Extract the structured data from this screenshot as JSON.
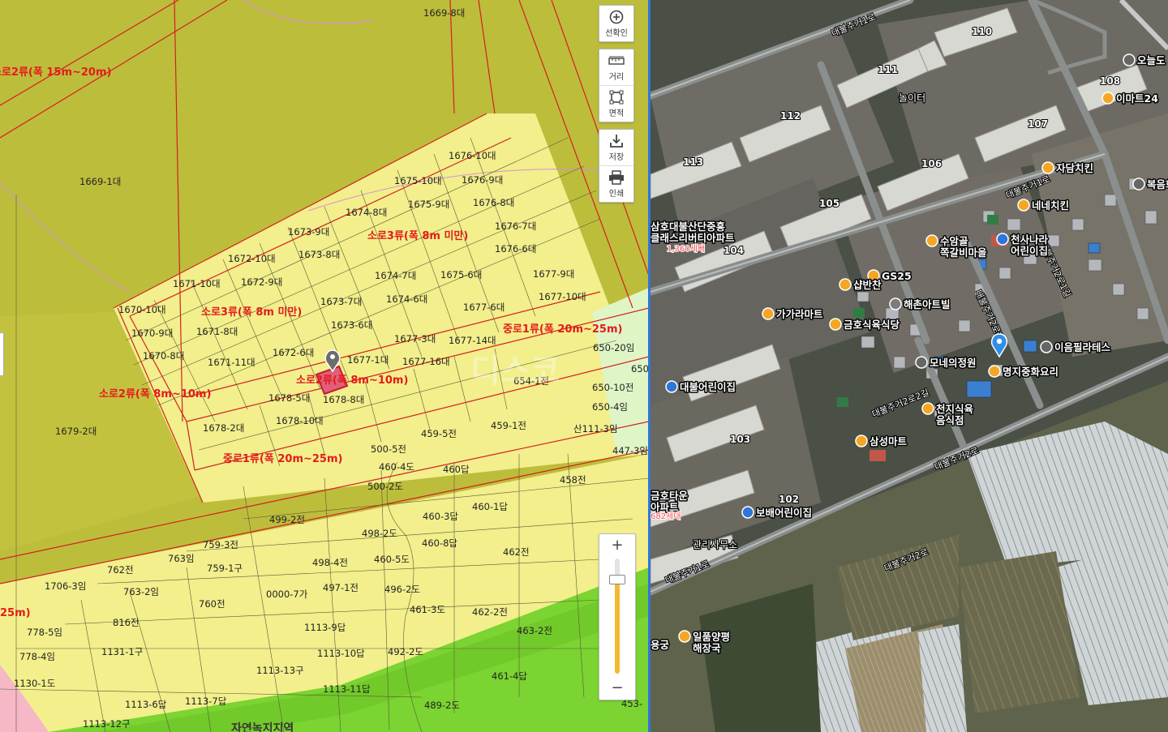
{
  "toolbar": {
    "buttons": [
      {
        "id": "select",
        "label": "선확인",
        "icon": "plus-circle-icon"
      },
      {
        "id": "distance",
        "label": "거리",
        "icon": "ruler-icon"
      },
      {
        "id": "area",
        "label": "면적",
        "icon": "area-icon"
      },
      {
        "id": "save",
        "label": "저장",
        "icon": "download-icon"
      },
      {
        "id": "print",
        "label": "인쇄",
        "icon": "printer-icon"
      }
    ]
  },
  "zoom": {
    "plus": "+",
    "minus": "−",
    "level": 0.85
  },
  "watermark": "디스코",
  "cadastral": {
    "parcels": [
      "1669-8대",
      "1669-1대",
      "1679-2대",
      "1676-10대",
      "1676-9대",
      "1675-10대",
      "1675-9대",
      "1676-8대",
      "1674-8대",
      "1676-7대",
      "1673-9대",
      "1676-6대",
      "1672-10대",
      "1673-8대",
      "1675-6대",
      "1677-9대",
      "1671-10대",
      "1672-9대",
      "1674-7대",
      "1677-10대",
      "1670-10대",
      "1673-7대",
      "1674-6대",
      "1677-6대",
      "1670-9대",
      "1671-8대",
      "1673-6대",
      "1677-3대",
      "1677-14대",
      "1670-8대",
      "1672-6대",
      "1671-11대",
      "1677-1대",
      "1677-16대",
      "1678-5대",
      "1678-8대",
      "1678-10대",
      "1678-2대",
      "650-20임",
      "650",
      "654-1전",
      "650-10전",
      "650-4임",
      "459-1전",
      "459-5전",
      "산111-3임",
      "447-3임",
      "500-5전",
      "460-4도",
      "460답",
      "500-2도",
      "458전",
      "499-2전",
      "460-3답",
      "460-1답",
      "759-3전",
      "498-2도",
      "460-8답",
      "763임",
      "462전",
      "762전",
      "759-1구",
      "498-4전",
      "460-5도",
      "1706-3임",
      "763-2임",
      "497-1전",
      "496-2도",
      "760전",
      "0000-7가",
      "461-3도",
      "462-2전",
      "778-5임",
      "816전",
      "1113-9답",
      "463-2전",
      "778-4임",
      "1131-1구",
      "1113-10답",
      "492-2도",
      "1113-13구",
      "461-4답",
      "1130-1도",
      "1113-11답",
      "1113-6답",
      "1113-7답",
      "489-2도",
      "1113-12구",
      "453-"
    ],
    "roads": [
      "소로2류(폭 15m~20m)",
      "소로3류(폭 8m 미만)",
      "소로3류(폭 8m 미만)",
      "중로1류(폭 20m~25m)",
      "소로2류(폭 8m~10m)",
      "소로2류(폭 8m~10m)",
      "중로1류(폭 20m~25m)",
      "25m)"
    ],
    "zones": [
      "자연녹지지역"
    ]
  },
  "satellite": {
    "roads": [
      "대불주거1로",
      "대불주거1로",
      "대불주거2로",
      "대불주거2로",
      "대불주거2로2길",
      "대불주거2로3길",
      "대불주거2로1길",
      "대불주거1로"
    ],
    "buildings": [
      "110",
      "111",
      "112",
      "113",
      "108",
      "107",
      "106",
      "105",
      "104",
      "103",
      "102"
    ],
    "labels": [
      "놀이터",
      "관리사무소"
    ],
    "pois": [
      {
        "name": "오늘도",
        "type": "person"
      },
      {
        "name": "이마트24",
        "type": "shop"
      },
      {
        "name": "자담치킨",
        "type": "food"
      },
      {
        "name": "복음화교회",
        "type": "church"
      },
      {
        "name": "네네치킨",
        "type": "food"
      },
      {
        "name": "삼호대불산단중흥\n클래스리버티아파트",
        "type": "apt"
      },
      {
        "name": "수암골\n쪽갈비마을",
        "type": "food"
      },
      {
        "name": "천사나라\n어린이집",
        "type": "kid"
      },
      {
        "name": "GS25",
        "type": "shop"
      },
      {
        "name": "샵반찬",
        "type": "shop"
      },
      {
        "name": "가가라마트",
        "type": "shop"
      },
      {
        "name": "해촌아트빌",
        "type": "apt"
      },
      {
        "name": "금호식육식당",
        "type": "food"
      },
      {
        "name": "모네의정원",
        "type": "person"
      },
      {
        "name": "이음필라테스",
        "type": "person"
      },
      {
        "name": "명지중화요리",
        "type": "food"
      },
      {
        "name": "대불어린이집",
        "type": "kid"
      },
      {
        "name": "천지식육\n음식점",
        "type": "food"
      },
      {
        "name": "삼성마트",
        "type": "shop"
      },
      {
        "name": "금호타운\n아파트",
        "type": "apt"
      },
      {
        "name": "보배어린이집",
        "type": "kid"
      },
      {
        "name": "일품양평\n해장국",
        "type": "food"
      },
      {
        "name": "용궁",
        "type": "food"
      }
    ],
    "households": [
      "1,360세대",
      "682세대"
    ],
    "colors": {
      "poi_food": "#f5a623",
      "poi_kid": "#2f76d9",
      "marker": "#2f8fe8"
    }
  }
}
